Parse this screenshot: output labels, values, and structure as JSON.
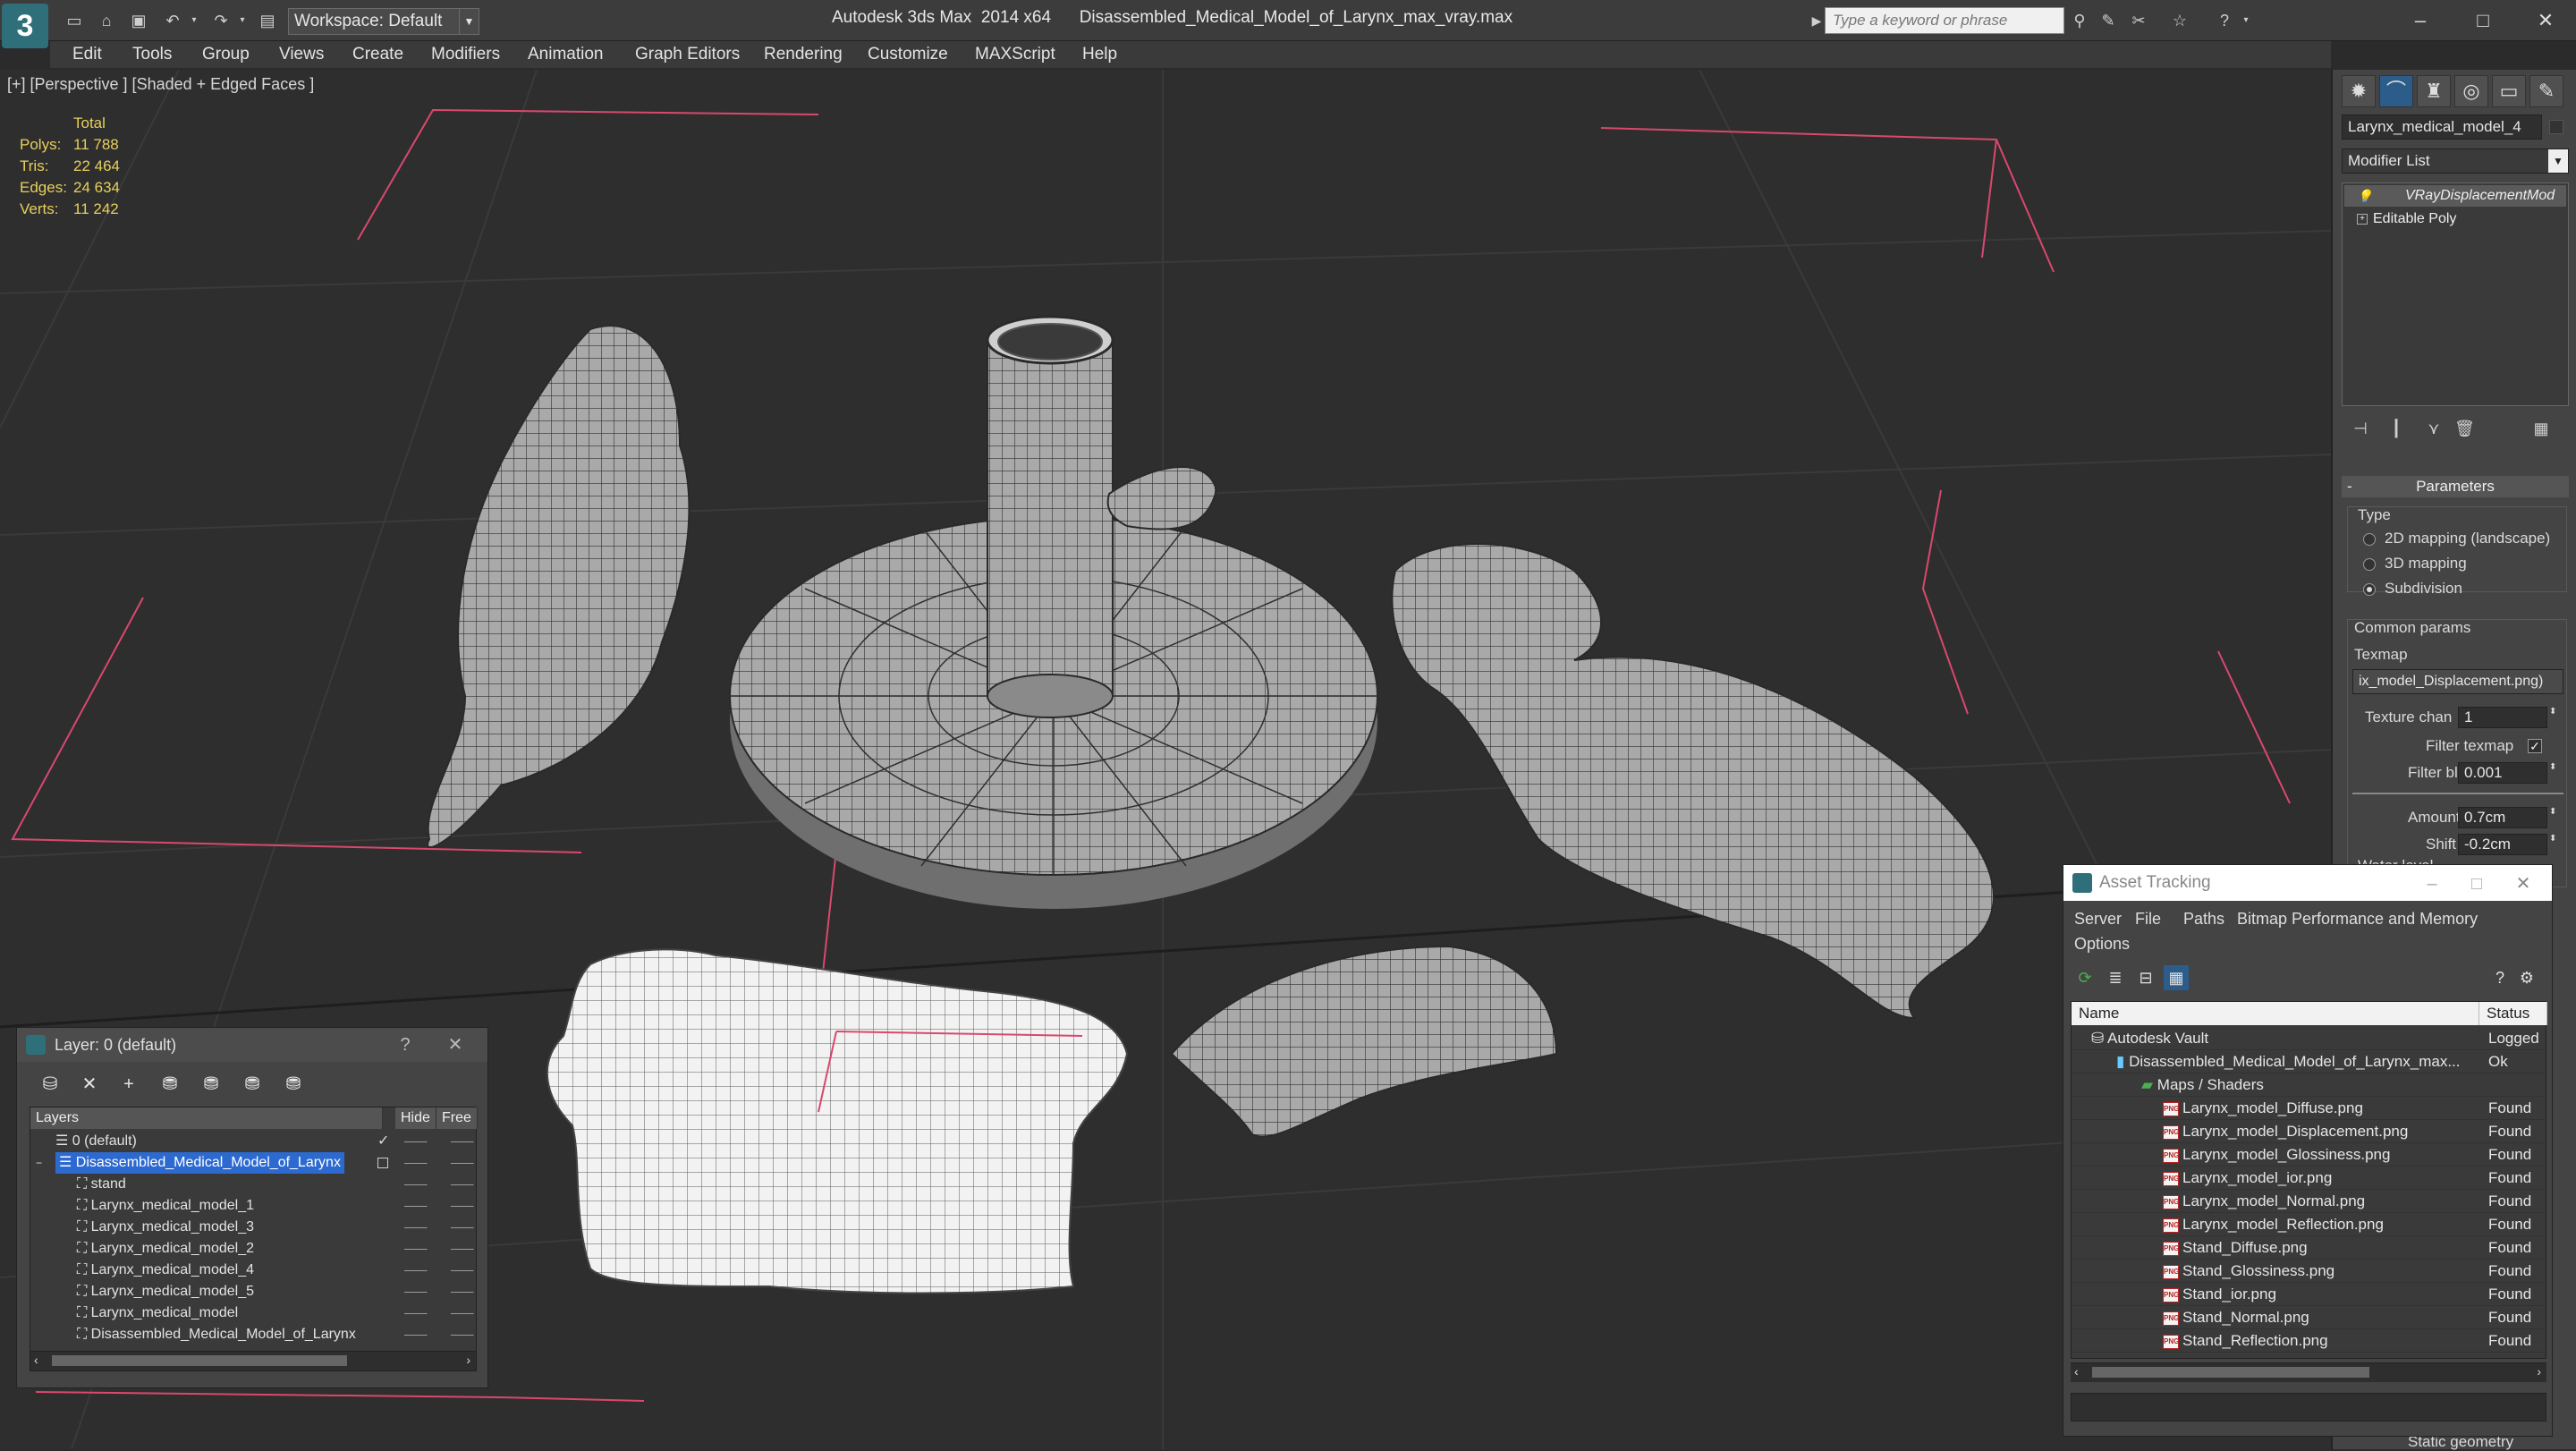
{
  "app": {
    "logo_letter": "3",
    "title": "Autodesk 3ds Max  2014 x64      Disassembled_Medical_Model_of_Larynx_max_vray.max",
    "workspace_label": "Workspace: Default",
    "search_placeholder": "Type a keyword or phrase"
  },
  "menu": [
    "Edit",
    "Tools",
    "Group",
    "Views",
    "Create",
    "Modifiers",
    "Animation",
    "Graph Editors",
    "Rendering",
    "Customize",
    "MAXScript",
    "Help"
  ],
  "viewport": {
    "label": "[+] [Perspective ] [Shaded + Edged Faces ]",
    "stats_header": "Total",
    "stats": [
      {
        "key": "Polys:",
        "value": "11 788"
      },
      {
        "key": "Tris:",
        "value": "22 464"
      },
      {
        "key": "Edges:",
        "value": "24 634"
      },
      {
        "key": "Verts:",
        "value": "11 242"
      }
    ]
  },
  "command_panel": {
    "object_name": "Larynx_medical_model_4",
    "modifier_list_label": "Modifier List",
    "stack": [
      "VRayDisplacementMod",
      "Editable Poly"
    ],
    "parameters_title": "Parameters",
    "type_label": "Type",
    "type_options": [
      "2D mapping (landscape)",
      "3D mapping",
      "Subdivision"
    ],
    "type_selected": "Subdivision",
    "common_params_label": "Common params",
    "texmap_label": "Texmap",
    "texmap_value": "ix_model_Displacement.png)",
    "texture_chan_label": "Texture chan",
    "texture_chan_value": "1",
    "filter_texmap_label": "Filter texmap",
    "filter_blur_label": "Filter blur",
    "filter_blur_value": "0.001",
    "amount_label": "Amount",
    "amount_value": "0.7cm",
    "shift_label": "Shift",
    "shift_value": "-0.2cm",
    "water_level_label": "Water level",
    "static_geometry_label": "Static geometry"
  },
  "layer_dialog": {
    "title": "Layer: 0 (default)",
    "columns": [
      "Layers",
      "Hide",
      "Free"
    ],
    "rows": [
      {
        "name": "0 (default)",
        "level": 0,
        "kind": "layer"
      },
      {
        "name": "Disassembled_Medical_Model_of_Larynx",
        "level": 0,
        "kind": "layer",
        "selected": true
      },
      {
        "name": "stand",
        "level": 1,
        "kind": "object"
      },
      {
        "name": "Larynx_medical_model_1",
        "level": 1,
        "kind": "object"
      },
      {
        "name": "Larynx_medical_model_3",
        "level": 1,
        "kind": "object"
      },
      {
        "name": "Larynx_medical_model_2",
        "level": 1,
        "kind": "object"
      },
      {
        "name": "Larynx_medical_model_4",
        "level": 1,
        "kind": "object"
      },
      {
        "name": "Larynx_medical_model_5",
        "level": 1,
        "kind": "object"
      },
      {
        "name": "Larynx_medical_model",
        "level": 1,
        "kind": "object"
      },
      {
        "name": "Disassembled_Medical_Model_of_Larynx",
        "level": 1,
        "kind": "object"
      }
    ]
  },
  "asset_tracking": {
    "title": "Asset Tracking",
    "menu": [
      "Server",
      "File",
      "Paths",
      "Bitmap Performance and Memory",
      "Options"
    ],
    "columns": [
      "Name",
      "Status"
    ],
    "rows": [
      {
        "name": "Autodesk Vault",
        "status": "Logged",
        "level": 0,
        "icon": "vault"
      },
      {
        "name": "Disassembled_Medical_Model_of_Larynx_max...",
        "status": "Ok",
        "level": 1,
        "icon": "max"
      },
      {
        "name": "Maps / Shaders",
        "status": "",
        "level": 2,
        "icon": "folder"
      },
      {
        "name": "Larynx_model_Diffuse.png",
        "status": "Found",
        "level": 3,
        "icon": "png"
      },
      {
        "name": "Larynx_model_Displacement.png",
        "status": "Found",
        "level": 3,
        "icon": "png"
      },
      {
        "name": "Larynx_model_Glossiness.png",
        "status": "Found",
        "level": 3,
        "icon": "png"
      },
      {
        "name": "Larynx_model_ior.png",
        "status": "Found",
        "level": 3,
        "icon": "png"
      },
      {
        "name": "Larynx_model_Normal.png",
        "status": "Found",
        "level": 3,
        "icon": "png"
      },
      {
        "name": "Larynx_model_Reflection.png",
        "status": "Found",
        "level": 3,
        "icon": "png"
      },
      {
        "name": "Stand_Diffuse.png",
        "status": "Found",
        "level": 3,
        "icon": "png"
      },
      {
        "name": "Stand_Glossiness.png",
        "status": "Found",
        "level": 3,
        "icon": "png"
      },
      {
        "name": "Stand_ior.png",
        "status": "Found",
        "level": 3,
        "icon": "png"
      },
      {
        "name": "Stand_Normal.png",
        "status": "Found",
        "level": 3,
        "icon": "png"
      },
      {
        "name": "Stand_Reflection.png",
        "status": "Found",
        "level": 3,
        "icon": "png"
      }
    ]
  },
  "colors": {
    "selection_blue": "#2d6ad0",
    "stats_yellow": "#e8d05a",
    "bounding_pink": "#d9486e"
  }
}
